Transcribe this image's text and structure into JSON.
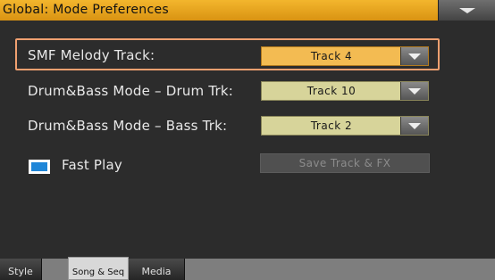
{
  "window": {
    "title": "Global: Mode Preferences",
    "menu_icon": "chevron-down-icon"
  },
  "settings": {
    "smf_melody_track": {
      "label": "SMF Melody Track:",
      "value": "Track 4"
    },
    "db_drum_track": {
      "label": "Drum&Bass Mode – Drum Trk:",
      "value": "Track 10"
    },
    "db_bass_track": {
      "label": "Drum&Bass Mode – Bass Trk:",
      "value": "Track 2"
    },
    "fast_play": {
      "label": "Fast Play",
      "checked": true
    },
    "save_track_fx": {
      "label": "Save Track & FX",
      "enabled": false
    }
  },
  "tabs": [
    {
      "label": "Style",
      "selected": false
    },
    {
      "label": "Song & Seq",
      "selected": true
    },
    {
      "label": "Media",
      "selected": false
    }
  ],
  "colors": {
    "title_bar": "#f0b02a",
    "active_selector": "#f3bb52",
    "selector": "#d7d49a",
    "focus_outline": "#f0a070",
    "checkbox_fill": "#1f86d8"
  }
}
